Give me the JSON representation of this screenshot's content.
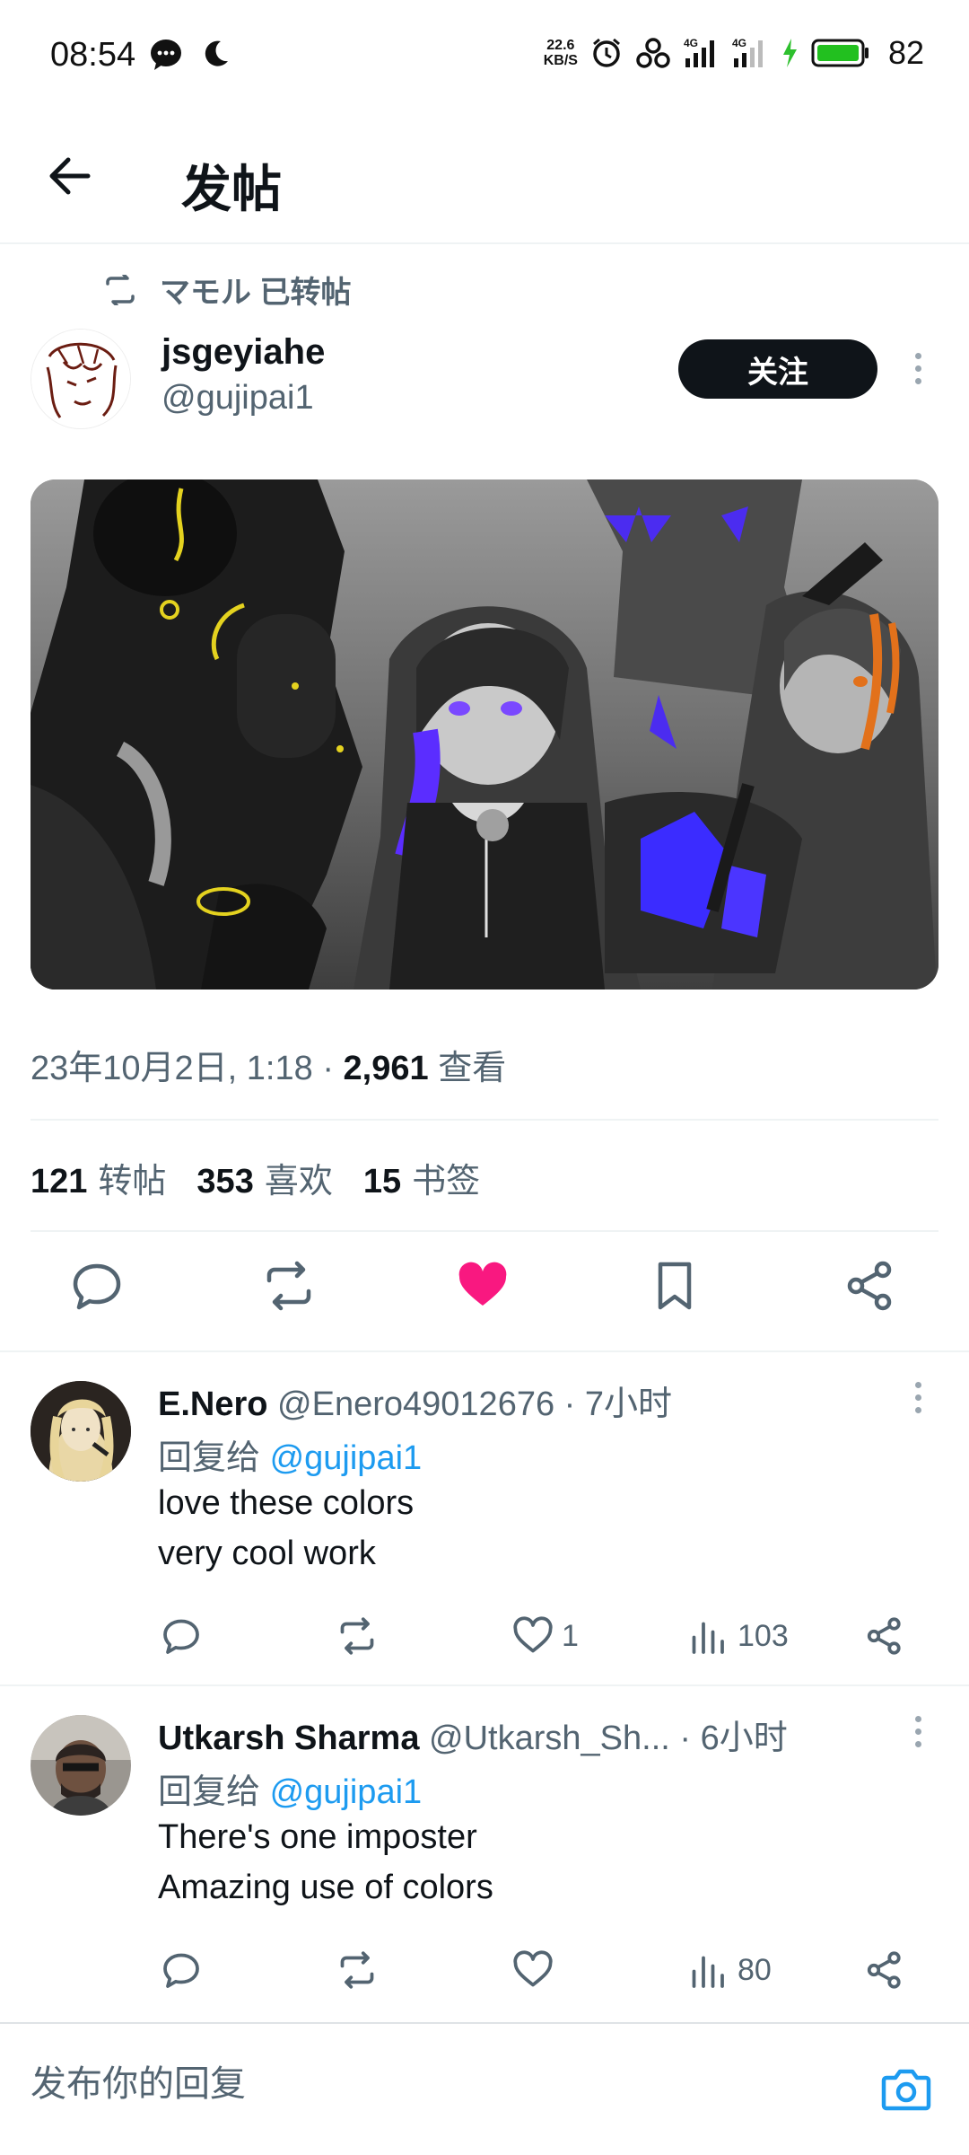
{
  "status_bar": {
    "time": "08:54",
    "speed_value": "22.6",
    "speed_unit": "KB/S",
    "network_1": "4G",
    "network_2": "4G",
    "battery": "82",
    "icons": [
      "chat-bubble-icon",
      "moon-icon",
      "alarm-icon",
      "link-icon",
      "signal-icon",
      "signal-icon",
      "charging-icon",
      "battery-icon"
    ]
  },
  "header": {
    "title": "发帖",
    "back_icon": "arrow-left-icon"
  },
  "post": {
    "repost_label": "マモル 已转帖",
    "author_name": "jsgeyiahe",
    "author_handle": "@gujipai1",
    "follow_label": "关注",
    "date": "23年10月2日, 1:18",
    "dot": "·",
    "views": "2,961",
    "views_label": "查看",
    "reposts": "121",
    "reposts_label": "转帖",
    "likes": "353",
    "likes_label": "喜欢",
    "bookmarks": "15",
    "bookmarks_label": "书签",
    "liked": true,
    "like_color": "#f91880"
  },
  "replies": [
    {
      "name": "E.Nero",
      "handle": "@Enero49012676",
      "time": "· 7小时",
      "reply_to_label": "回复给",
      "reply_to_handle": "@gujipai1",
      "lines": [
        "love these colors",
        "very cool work"
      ],
      "likes": "1",
      "views": "103"
    },
    {
      "name": "Utkarsh Sharma",
      "handle": "@Utkarsh_Sh...",
      "time": "· 6小时",
      "reply_to_label": "回复给",
      "reply_to_handle": "@gujipai1",
      "lines": [
        "There's one imposter",
        "Amazing use of colors"
      ],
      "likes": "",
      "views": "80"
    }
  ],
  "composer": {
    "placeholder": "发布你的回复",
    "accent": "#1d9bf0"
  }
}
